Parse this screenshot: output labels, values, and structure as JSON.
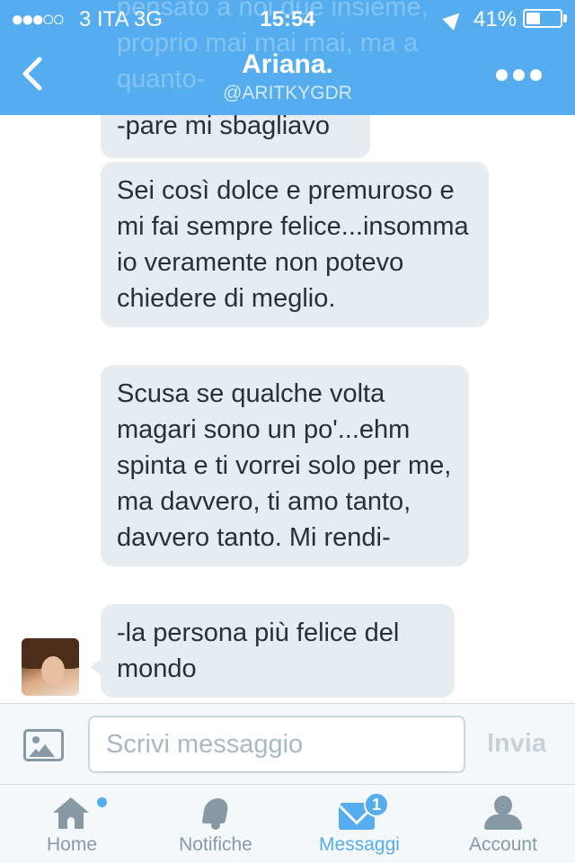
{
  "status_bar": {
    "signal": "●●●○○",
    "carrier": "3 ITA   3G",
    "time": "15:54",
    "battery": "41%",
    "battery_level": 0.41
  },
  "header": {
    "background_text": "pensato a noi due insieme, proprio mai mai mai, ma a quanto-",
    "title": "Ariana.",
    "handle": "@ARITKYGDR"
  },
  "messages": [
    {
      "text": "-pare mi sbagliavo"
    },
    {
      "text": "Sei così dolce e premuroso e mi fai sempre felice...insomma io veramente non potevo chiedere di meglio."
    },
    {
      "text": "Scusa se qualche volta magari sono un po'...ehm spinta e ti vorrei solo per me, ma davvero, ti amo tanto, davvero tanto. Mi rendi-"
    },
    {
      "text": "-la persona più felice del mondo"
    }
  ],
  "composer": {
    "placeholder": "Scrivi messaggio",
    "value": "",
    "send_label": "Invia"
  },
  "tabs": [
    {
      "label": "Home",
      "icon": "home-icon",
      "active": false
    },
    {
      "label": "Notifiche",
      "icon": "bell-icon",
      "active": false
    },
    {
      "label": "Messaggi",
      "icon": "envelope-icon",
      "active": true,
      "badge": "1"
    },
    {
      "label": "Account",
      "icon": "person-icon",
      "active": false
    }
  ],
  "colors": {
    "accent": "#55acee",
    "bubble": "#e6ecf0",
    "inactive_icon": "#8899a6"
  }
}
